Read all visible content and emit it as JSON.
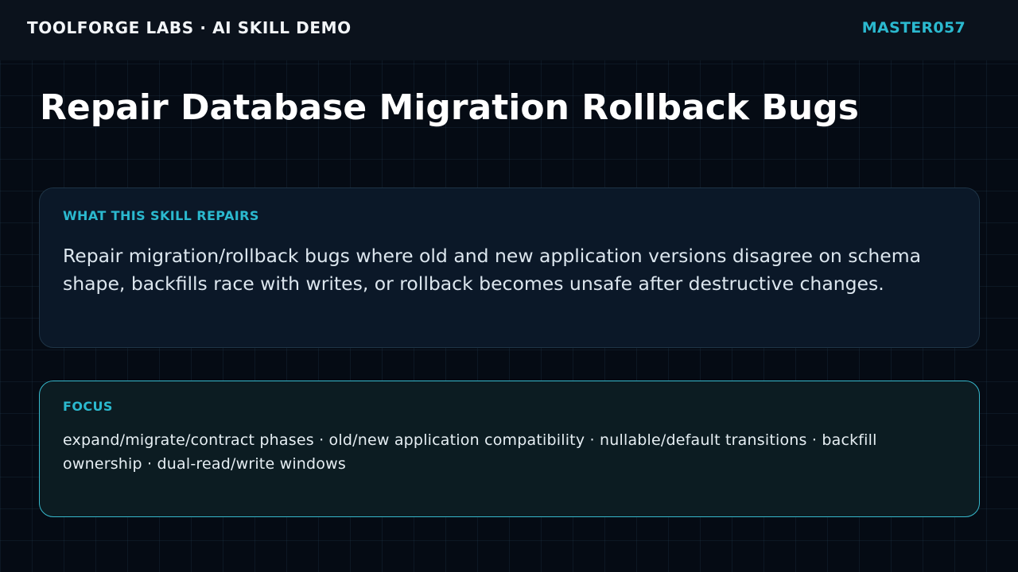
{
  "header": {
    "brand": "TOOLFORGE LABS · AI SKILL DEMO",
    "code": "MASTER057"
  },
  "page": {
    "title": "Repair Database Migration Rollback Bugs"
  },
  "repairs_card": {
    "label": "WHAT THIS SKILL REPAIRS",
    "text": "Repair migration/rollback bugs where old and new application versions disagree on schema shape, backfills race with writes, or rollback becomes unsafe after destructive changes."
  },
  "focus_card": {
    "label": "FOCUS",
    "text": "expand/migrate/contract phases · old/new application compatibility · nullable/default transitions · backfill ownership · dual-read/write windows"
  },
  "colors": {
    "accent": "#2bb9cf",
    "background": "#050b14",
    "card": "#0b1828",
    "focus_border": "#36b8cc"
  }
}
